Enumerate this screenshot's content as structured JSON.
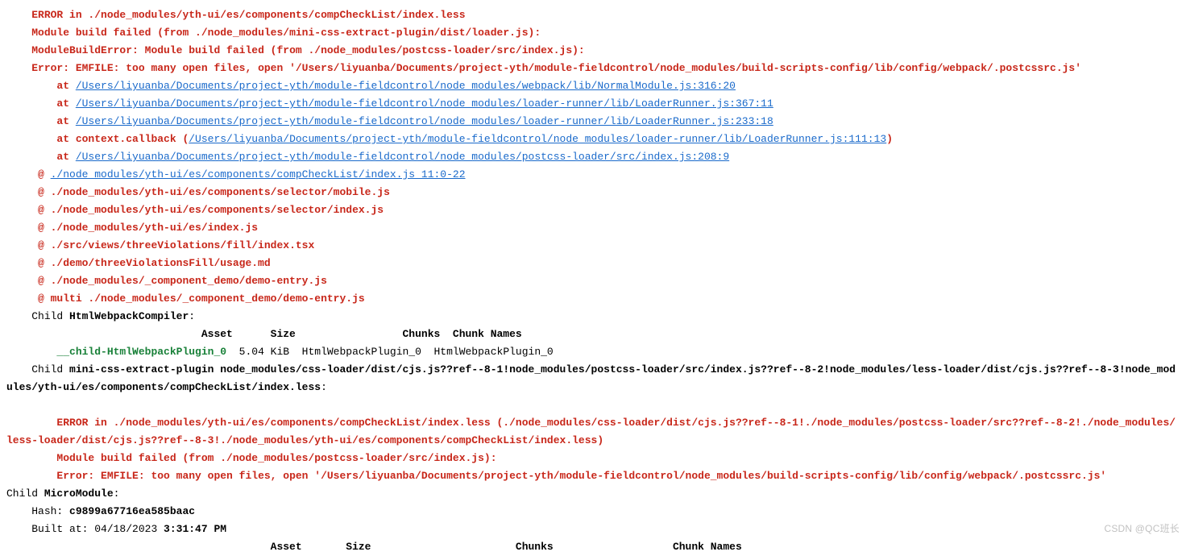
{
  "block1": {
    "l1": "    ERROR in ./node_modules/yth-ui/es/components/compCheckList/index.less",
    "l2": "    Module build failed (from ./node_modules/mini-css-extract-plugin/dist/loader.js):",
    "l3": "    ModuleBuildError: Module build failed (from ./node_modules/postcss-loader/src/index.js):",
    "l4": "    Error: EMFILE: too many open files, open '/Users/liyuanba/Documents/project-yth/module-fieldcontrol/node_modules/build-scripts-config/lib/config/webpack/.postcssrc.js'",
    "at": "        at ",
    "at_ctx_pre": "        at context.callback (",
    "at_ctx_suf": ")",
    "lk_a": "/Users/liyuanba/Documents/project-yth/module-fieldcontrol/node_modules/webpack/lib/NormalModule.js:316:20",
    "lk_b": "/Users/liyuanba/Documents/project-yth/module-fieldcontrol/node_modules/loader-runner/lib/LoaderRunner.js:367:11",
    "lk_c": "/Users/liyuanba/Documents/project-yth/module-fieldcontrol/node_modules/loader-runner/lib/LoaderRunner.js:233:18",
    "lk_d": "/Users/liyuanba/Documents/project-yth/module-fieldcontrol/node_modules/loader-runner/lib/LoaderRunner.js:111:13",
    "lk_e": "/Users/liyuanba/Documents/project-yth/module-fieldcontrol/node_modules/postcss-loader/src/index.js:208:9",
    "at_at": "     @ ",
    "lk_at": "./node_modules/yth-ui/es/components/compCheckList/index.js 11:0-22",
    "s1": "     @ ./node_modules/yth-ui/es/components/selector/mobile.js",
    "s2": "     @ ./node_modules/yth-ui/es/components/selector/index.js",
    "s3": "     @ ./node_modules/yth-ui/es/index.js",
    "s4": "     @ ./src/views/threeViolations/fill/index.tsx",
    "s5": "     @ ./demo/threeViolationsFill/usage.md",
    "s6": "     @ ./node_modules/_component_demo/demo-entry.js",
    "s7": "     @ multi ./node_modules/_component_demo/demo-entry.js"
  },
  "compiler": {
    "pre": "    Child ",
    "name": "HtmlWebpackCompiler",
    "suf": ":",
    "hdr": "                               Asset      Size                 Chunks  Chunk Names",
    "row_pre": "        ",
    "row_asset": "__child-HtmlWebpackPlugin_0",
    "row_rest": "  5.04 KiB  HtmlWebpackPlugin_0  HtmlWebpackPlugin_0"
  },
  "child_css": {
    "pre": "    Child ",
    "bold": "mini-css-extract-plugin node_modules/css-loader/dist/cjs.js??ref--8-1!node_modules/postcss-loader/src/index.js??ref--8-2!node_modules/less-loader/dist/cjs.js??ref--8-3!node_modules/yth-ui/es/components/compCheckList/index.less",
    "suf": ":"
  },
  "block2": {
    "l1": "        ERROR in ./node_modules/yth-ui/es/components/compCheckList/index.less (./node_modules/css-loader/dist/cjs.js??ref--8-1!./node_modules/postcss-loader/src??ref--8-2!./node_modules/less-loader/dist/cjs.js??ref--8-3!./node_modules/yth-ui/es/components/compCheckList/index.less)",
    "l2": "        Module build failed (from ./node_modules/postcss-loader/src/index.js):",
    "l3": "        Error: EMFILE: too many open files, open '/Users/liyuanba/Documents/project-yth/module-fieldcontrol/node_modules/build-scripts-config/lib/config/webpack/.postcssrc.js'"
  },
  "micro": {
    "pre": "Child ",
    "name": "MicroModule",
    "suf": ":",
    "hash_pre": "    Hash: ",
    "hash": "c9899a67716ea585baac",
    "built_pre": "    Built at: 04/18/2023 ",
    "built_time": "3:31:47 PM",
    "hdr": "                                          Asset       Size                       Chunks                   Chunk Names"
  },
  "watermark": "CSDN @QC班长"
}
